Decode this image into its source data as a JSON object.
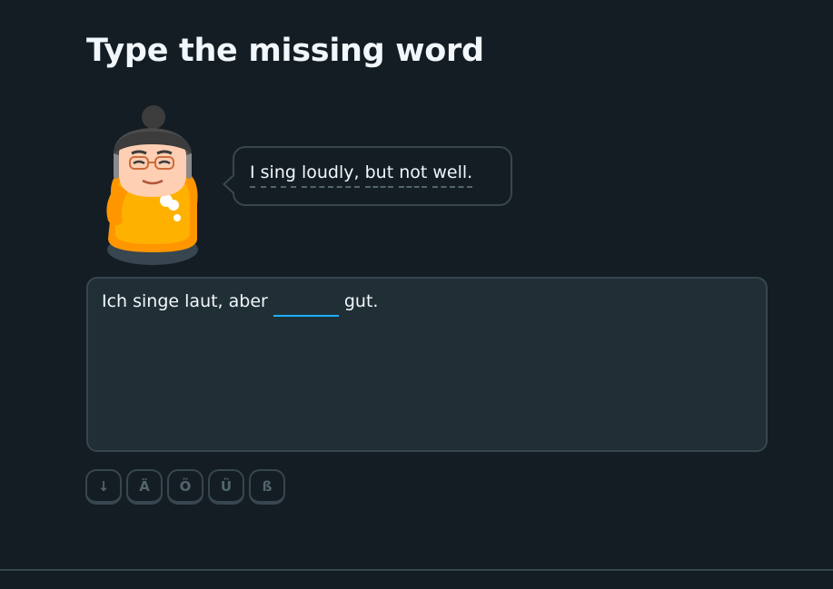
{
  "challenge": {
    "title": "Type the missing word"
  },
  "speech_bubble": {
    "words": [
      "I",
      "sing",
      "loudly,",
      "but",
      "not",
      "well."
    ]
  },
  "answer": {
    "prefix": "Ich singe laut, aber",
    "input_value": "",
    "suffix": "gut.",
    "input_underline_color": "#1cb0f6"
  },
  "keyboard": {
    "keys": [
      {
        "label": "↓",
        "icon": "chevron-down-icon"
      },
      {
        "label": "Ä"
      },
      {
        "label": "Ö"
      },
      {
        "label": "Ü"
      },
      {
        "label": "ß"
      }
    ]
  },
  "colors": {
    "background": "#141d24",
    "panel": "#202f36",
    "border": "#37464f",
    "text": "#f1f7fb",
    "muted": "#52656d",
    "accent": "#1cb0f6",
    "character_body": "#ffa500"
  }
}
